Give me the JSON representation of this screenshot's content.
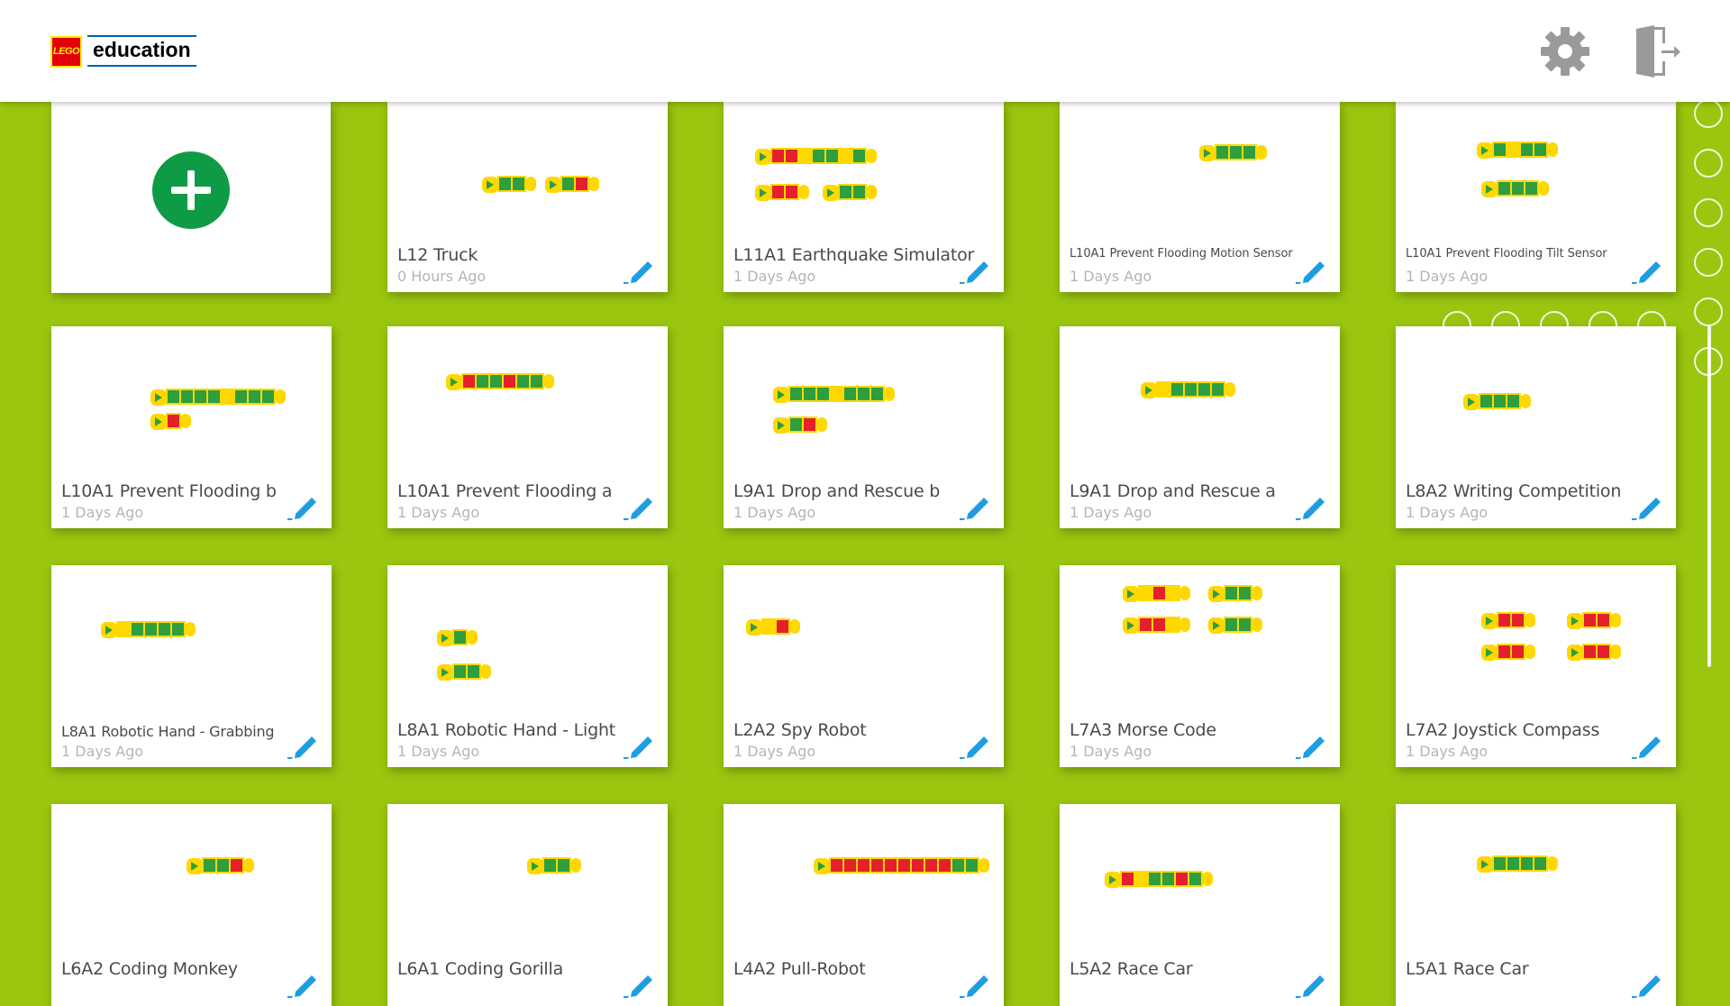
{
  "header": {
    "logo_brand": "LEGO",
    "logo_text": "education",
    "settings_icon": "gear-icon",
    "exit_icon": "exit-door-icon"
  },
  "new_project": {
    "icon": "plus-icon"
  },
  "projects": [
    {
      "title": "L12 Truck",
      "time": "0 Hours Ago"
    },
    {
      "title": "L11A1 Earthquake Simulator",
      "time": "1 Days Ago"
    },
    {
      "title": "L10A1 Prevent Flooding Motion Sensor",
      "time": "1 Days Ago"
    },
    {
      "title": "L10A1 Prevent Flooding Tilt Sensor",
      "time": "1 Days Ago"
    },
    {
      "title": "L10A1 Prevent Flooding b",
      "time": "1 Days Ago"
    },
    {
      "title": "L10A1 Prevent Flooding a",
      "time": "1 Days Ago"
    },
    {
      "title": "L9A1 Drop and Rescue b",
      "time": "1 Days Ago"
    },
    {
      "title": "L9A1 Drop and Rescue a",
      "time": "1 Days Ago"
    },
    {
      "title": "L8A2 Writing Competition",
      "time": "1 Days Ago"
    },
    {
      "title": "L8A1 Robotic Hand - Grabbing",
      "time": "1 Days Ago"
    },
    {
      "title": "L8A1 Robotic Hand - Light",
      "time": "1 Days Ago"
    },
    {
      "title": "L2A2 Spy Robot",
      "time": "1 Days Ago"
    },
    {
      "title": "L7A3 Morse Code",
      "time": "1 Days Ago"
    },
    {
      "title": "L7A2 Joystick Compass",
      "time": "1 Days Ago"
    },
    {
      "title": "L6A2 Coding Monkey",
      "time": ""
    },
    {
      "title": "L6A1 Coding Gorilla",
      "time": ""
    },
    {
      "title": "L4A2 Pull-Robot",
      "time": ""
    },
    {
      "title": "L5A2 Race Car",
      "time": ""
    },
    {
      "title": "L5A1 Race Car",
      "time": ""
    }
  ],
  "colors": {
    "background": "#9ac60f",
    "plus_button": "#0f9b45",
    "edit_icon": "#1e9ee0",
    "block_yellow": "#ffd800",
    "block_green": "#2e9e3e",
    "block_red": "#e3202b",
    "block_orange": "#f7941d"
  }
}
